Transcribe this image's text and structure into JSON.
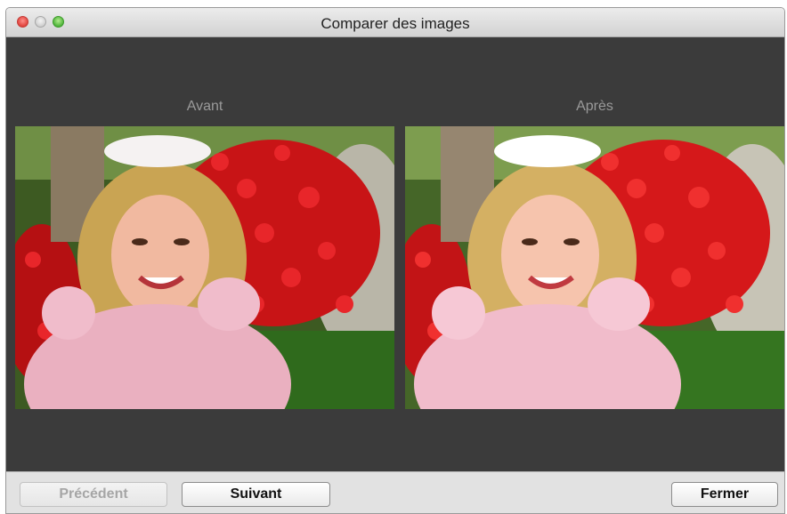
{
  "window": {
    "title": "Comparer des images"
  },
  "panes": {
    "before_label": "Avant",
    "after_label": "Après"
  },
  "buttons": {
    "previous": "Précédent",
    "next": "Suivant",
    "close": "Fermer"
  },
  "colors": {
    "content_background": "#3b3b3b",
    "label_text": "#9a9a9a",
    "close_light": "#e0443e",
    "minimize_light": "#cfcfcf",
    "zoom_light": "#4fb43a"
  }
}
